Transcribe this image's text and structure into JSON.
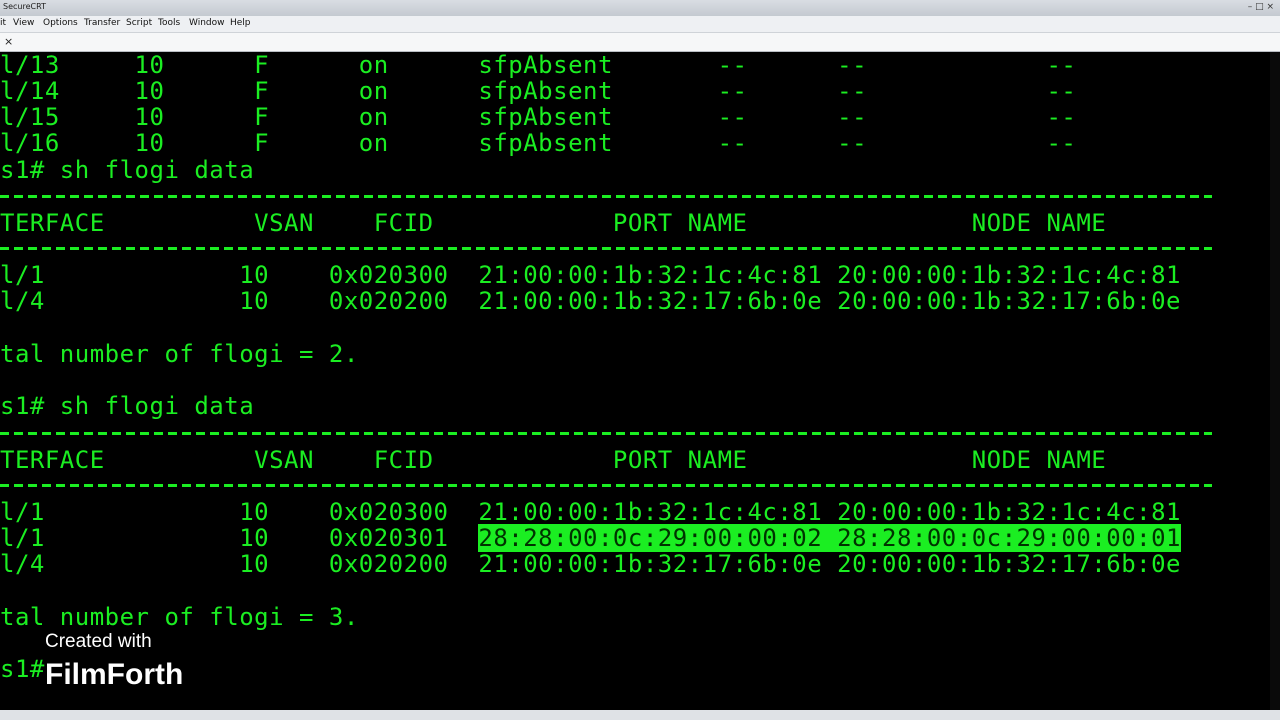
{
  "window": {
    "title": "SecureCRT",
    "controls": "– □ ×"
  },
  "menu": {
    "items": [
      "it",
      "View",
      "Options",
      "Transfer",
      "Script",
      "Tools",
      "Window",
      "Help"
    ]
  },
  "tabbar": {
    "close_glyph": "×"
  },
  "terminal": {
    "rows_block1": [
      "l/13     10      F      on      sfpAbsent       --      --            --",
      "l/14     10      F      on      sfpAbsent       --      --            --",
      "l/15     10      F      on      sfpAbsent       --      --            --",
      "l/16     10      F      on      sfpAbsent       --      --            --"
    ],
    "cmd1": "s1# sh flogi data",
    "header1": "TERFACE          VSAN    FCID            PORT NAME               NODE NAME",
    "flogi1": [
      "l/1             10    0x020300  21:00:00:1b:32:1c:4c:81 20:00:00:1b:32:1c:4c:81",
      "l/4             10    0x020200  21:00:00:1b:32:17:6b:0e 20:00:00:1b:32:17:6b:0e"
    ],
    "total1": "tal number of flogi = 2.",
    "cmd2": "s1# sh flogi data",
    "header2": "TERFACE          VSAN    FCID            PORT NAME               NODE NAME",
    "flogi2_row1": "l/1             10    0x020300  21:00:00:1b:32:1c:4c:81 20:00:00:1b:32:1c:4c:81",
    "flogi2_row2_prefix": "l/1             10    0x020301  ",
    "flogi2_row2_selected": "28:28:00:0c:29:00:00:02 28:28:00:0c:29:00:00:01",
    "flogi2_row3": "l/4             10    0x020200  21:00:00:1b:32:17:6b:0e 20:00:00:1b:32:17:6b:0e",
    "total2": "tal number of flogi = 3.",
    "prompt": "s1#"
  },
  "watermark": {
    "line1": "Created with",
    "line2": "FilmForth"
  },
  "colors": {
    "terminal_fg": "#1bee22",
    "terminal_bg": "#000000",
    "selection_bg": "#1bee22"
  }
}
